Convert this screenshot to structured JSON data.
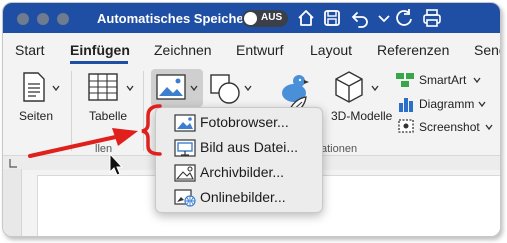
{
  "titlebar": {
    "app_title": "Automatisches Speichern",
    "autosave_toggle": "AUS"
  },
  "tabs": [
    "Start",
    "Einfügen",
    "Zeichnen",
    "Entwurf",
    "Layout",
    "Referenzen",
    "Send"
  ],
  "ribbon": {
    "pages_label": "Seiten",
    "table_label": "Tabelle",
    "models_label": "3D-Modelle",
    "smartart_label": "SmartArt",
    "chart_label": "Diagramm",
    "screenshot_label": "Screenshot",
    "group_fragment_left": "llen",
    "group_fragment_right": "ationen"
  },
  "menu": {
    "items": [
      {
        "label": "Fotobrowser...",
        "icon": "photo-browser-icon"
      },
      {
        "label": "Bild aus Datei...",
        "icon": "picture-from-file-icon"
      },
      {
        "label": "Archivbilder...",
        "icon": "stock-images-icon"
      },
      {
        "label": "Onlinebilder...",
        "icon": "online-pictures-icon"
      }
    ]
  },
  "colors": {
    "titlebar": "#1e4fa4",
    "accent": "#1e4fa4",
    "annotation_red": "#e0201d"
  }
}
